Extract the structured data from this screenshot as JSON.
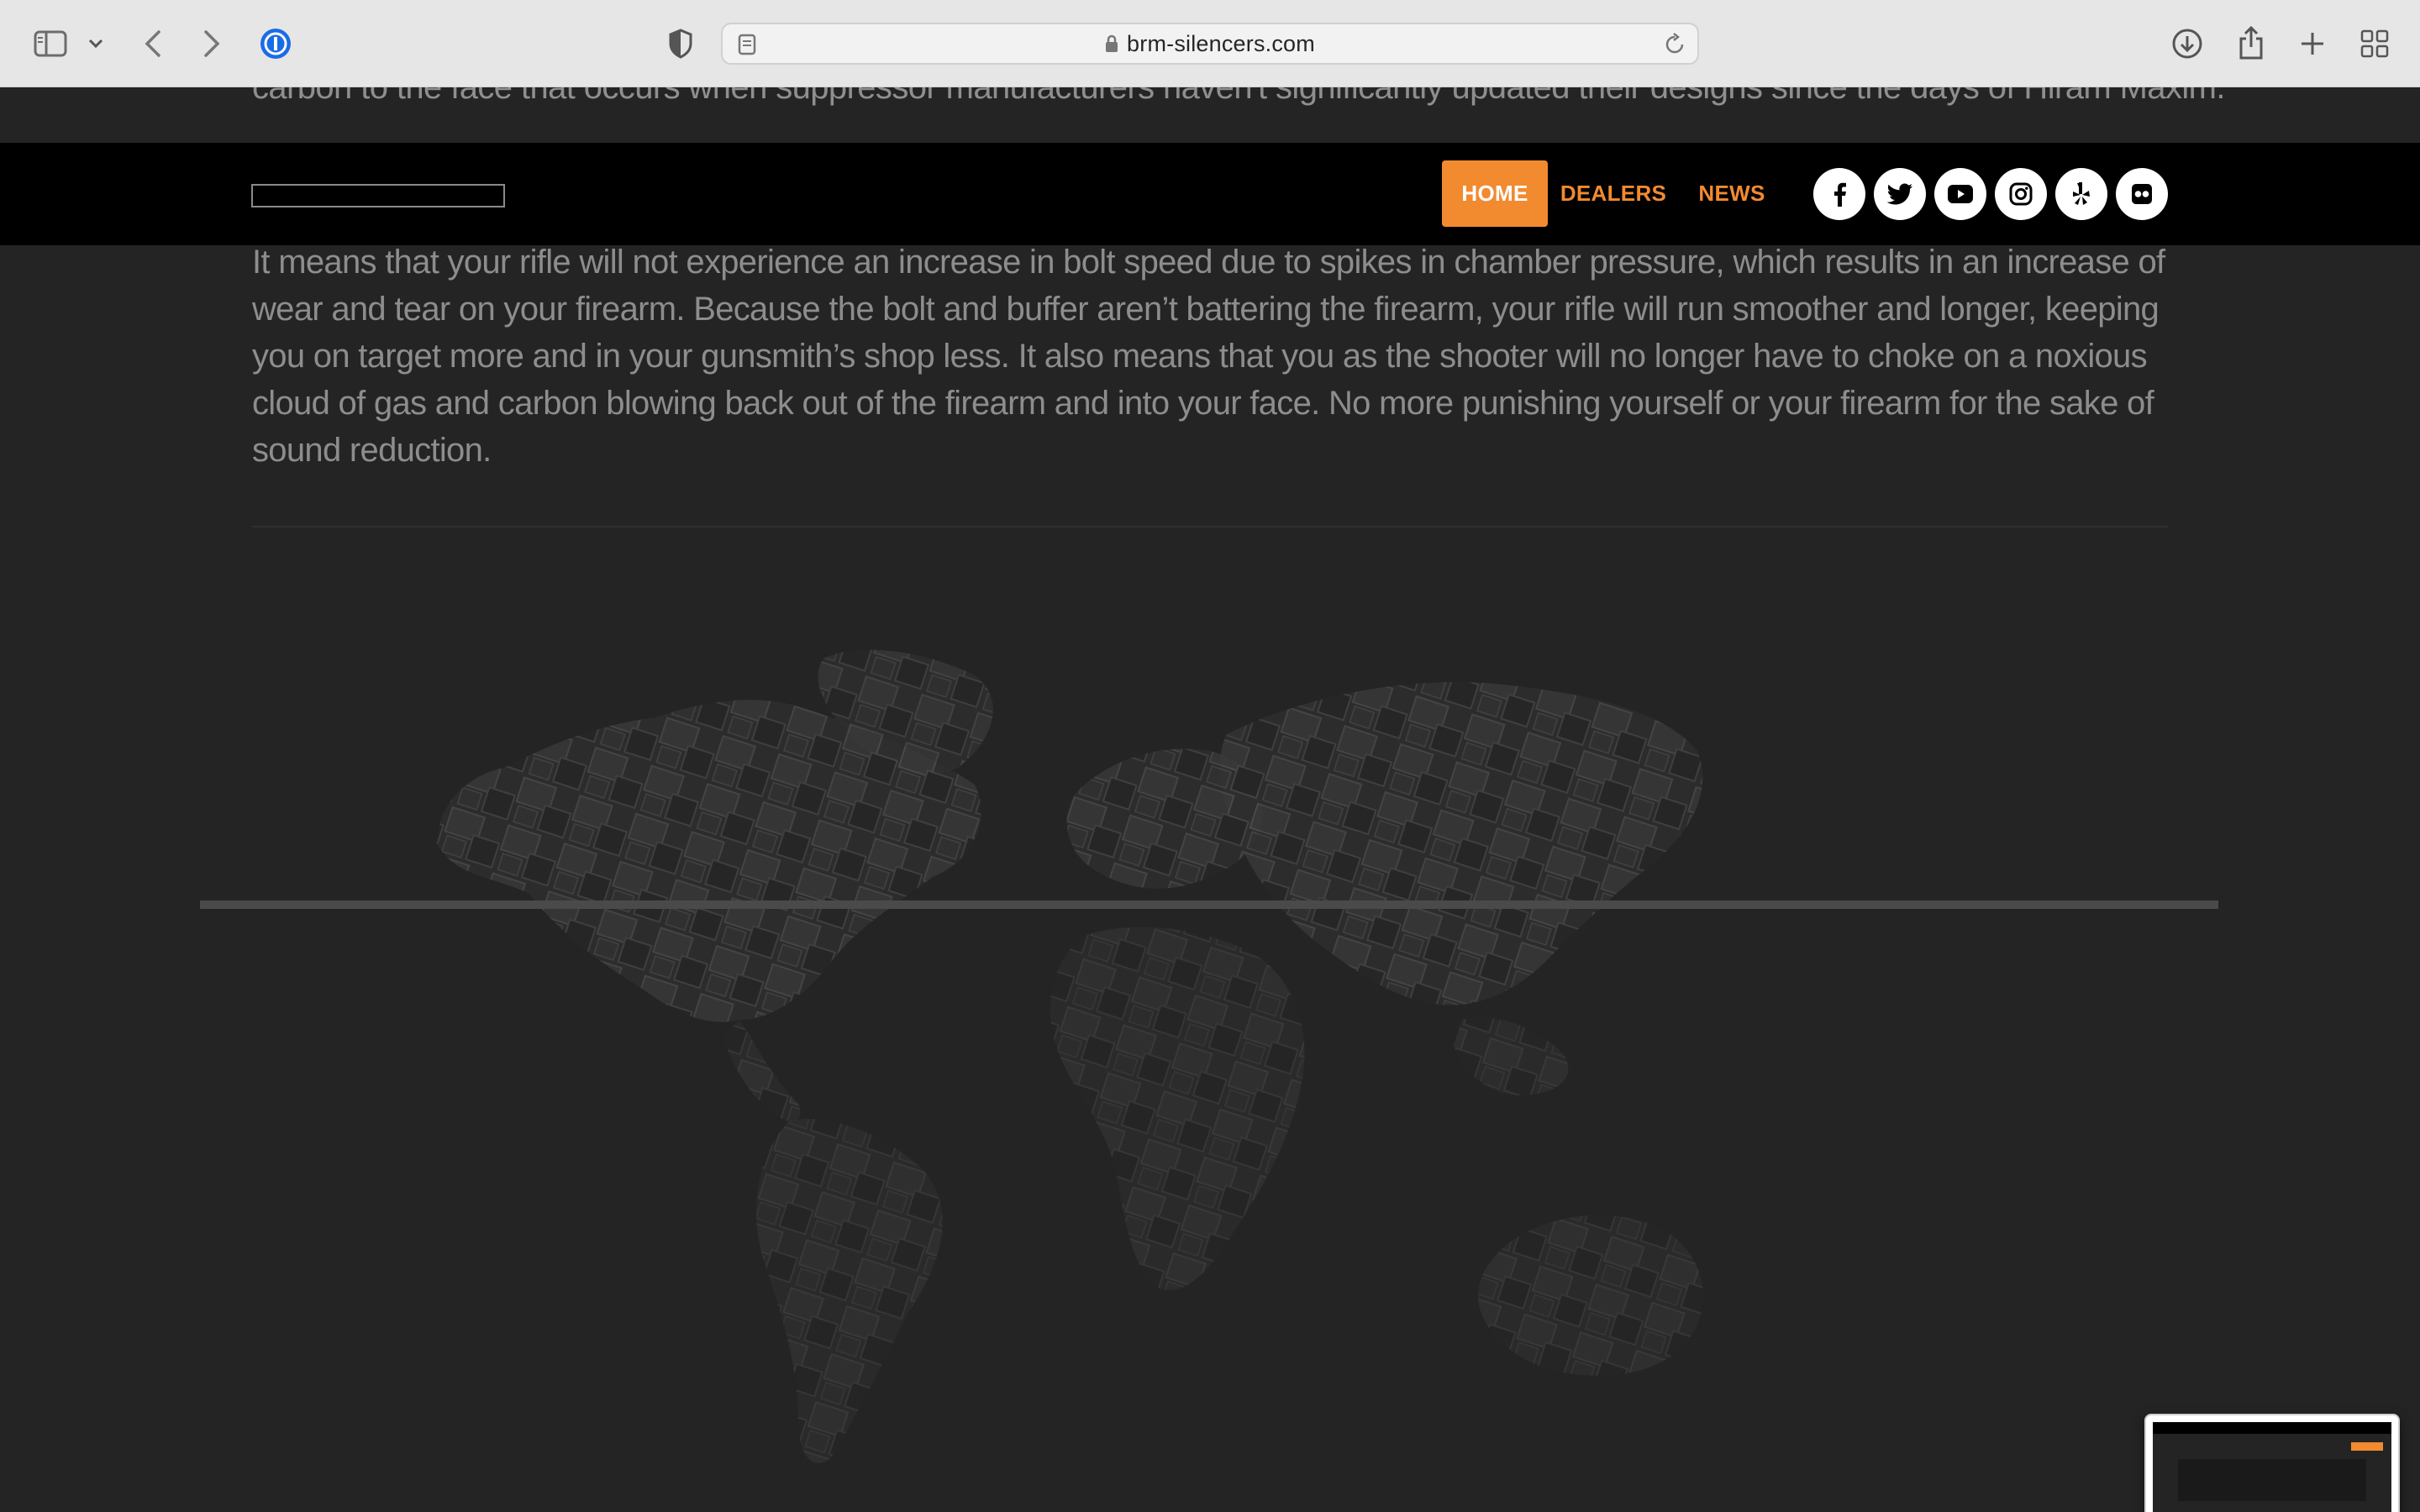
{
  "browser": {
    "url": "brm-silencers.com"
  },
  "page": {
    "cut_text": "carbon to the face that occurs when suppressor manufacturers haven't significantly updated their designs since the days of Hiram Maxim.",
    "nav": {
      "items": [
        {
          "label": "HOME",
          "active": true
        },
        {
          "label": "DEALERS",
          "active": false
        },
        {
          "label": "NEWS",
          "active": false
        }
      ],
      "social_icons": [
        "facebook-icon",
        "twitter-icon",
        "youtube-icon",
        "instagram-icon",
        "yelp-icon",
        "flickr-icon"
      ]
    },
    "paragraph": "It means that your rifle will not experience an increase in bolt speed due to spikes in chamber pressure, which results in an increase of wear and tear on your firearm. Because the bolt and buffer aren’t battering the firearm, your rifle will run smoother and longer, keeping you on target more and in your gunsmith’s shop less. It also means that you as the shooter will no longer have to choke on a noxious cloud of gas and carbon blowing back out of the firearm and into your face. No more punishing yourself or your firearm for the sake of sound reduction."
  },
  "colors": {
    "accent": "#f28a30",
    "page_bg": "#242424",
    "nav_bg": "#000000"
  }
}
